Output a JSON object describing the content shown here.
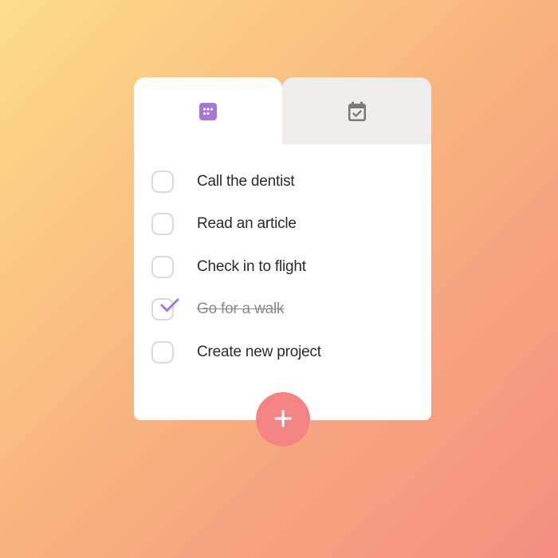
{
  "tabs": [
    {
      "icon": "grid-calendar-icon",
      "active": true
    },
    {
      "icon": "calendar-check-icon",
      "active": false
    }
  ],
  "tasks": [
    {
      "label": "Call the dentist",
      "done": false
    },
    {
      "label": "Read an article",
      "done": false
    },
    {
      "label": "Check in to flight",
      "done": false
    },
    {
      "label": "Go for a walk",
      "done": true
    },
    {
      "label": "Create new project",
      "done": false
    }
  ],
  "fab": {
    "icon": "plus-icon"
  },
  "colors": {
    "accent": "#a776d8",
    "fab": "#f48383",
    "inactive_tab": "#efedeb",
    "checkbox_border": "#dcd9d5",
    "inactive_icon": "#7c7a78"
  }
}
